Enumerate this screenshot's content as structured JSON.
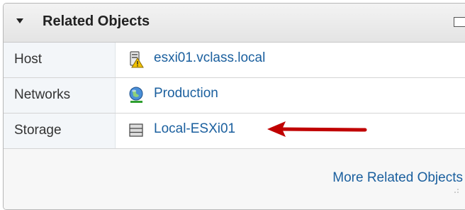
{
  "panel": {
    "title": "Related Objects",
    "footer_link": "More Related Objects"
  },
  "rows": [
    {
      "label": "Host",
      "value": "esxi01.vclass.local",
      "icon": "host-warning-icon"
    },
    {
      "label": "Networks",
      "value": "Production",
      "icon": "network-globe-icon"
    },
    {
      "label": "Storage",
      "value": "Local-ESXi01",
      "icon": "datastore-icon"
    }
  ],
  "colors": {
    "link": "#1a5f9e",
    "arrow": "#c00000",
    "warning": "#f2c200"
  }
}
